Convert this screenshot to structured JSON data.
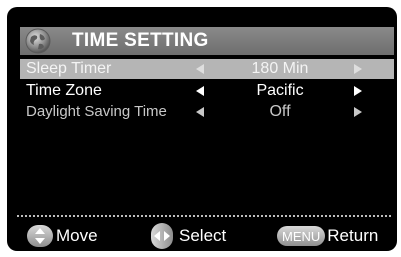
{
  "header": {
    "title": "TIME SETTING",
    "icon": "globe-icon"
  },
  "rows": [
    {
      "label": "Sleep Timer",
      "value": "180 Min",
      "state": "selected"
    },
    {
      "label": "Time Zone",
      "value": "Pacific",
      "state": "normal"
    },
    {
      "label": "Daylight Saving Time",
      "value": "Off",
      "state": "dim"
    }
  ],
  "footer": {
    "move_label": "Move",
    "select_label": "Select",
    "menu_key": "MENU",
    "return_label": "Return"
  },
  "colors": {
    "background": "#000000",
    "header": "#7a7a7a",
    "selected_row": "#b5b5b5",
    "text": "#ffffff"
  }
}
